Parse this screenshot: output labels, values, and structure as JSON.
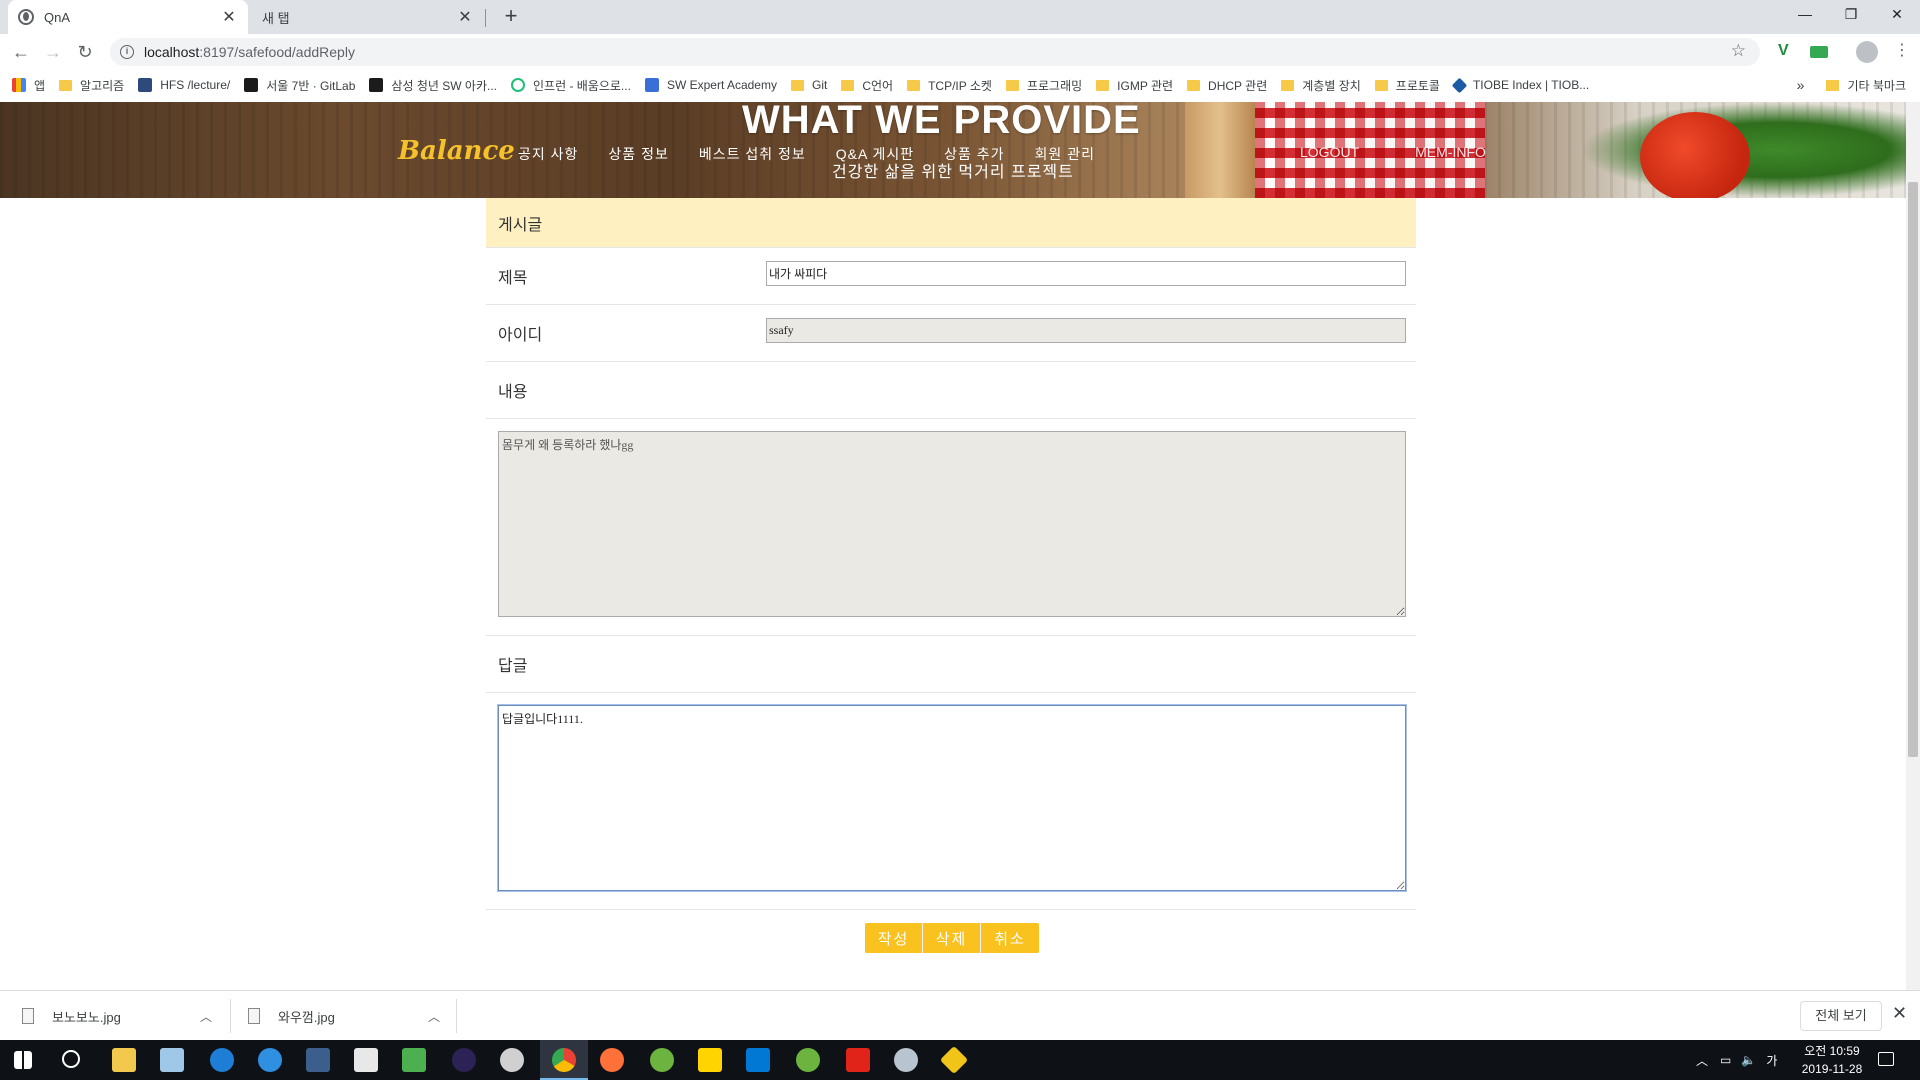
{
  "browser": {
    "tabs": [
      {
        "title": "QnA",
        "active": true
      },
      {
        "title": "새 탭",
        "active": false
      }
    ],
    "url_host": "localhost",
    "url_path": ":8197/safefood/addReply",
    "bookmarks": [
      {
        "label": "앱",
        "kind": "apps"
      },
      {
        "label": "알고리즘",
        "kind": "folder"
      },
      {
        "label": "HFS /lecture/",
        "kind": "site"
      },
      {
        "label": "서울 7반 · GitLab",
        "kind": "site"
      },
      {
        "label": "삼성 청년 SW 아카...",
        "kind": "site"
      },
      {
        "label": "인프런 - 배움으로...",
        "kind": "site"
      },
      {
        "label": "SW Expert Academy",
        "kind": "site"
      },
      {
        "label": "Git",
        "kind": "folder"
      },
      {
        "label": "C언어",
        "kind": "folder"
      },
      {
        "label": "TCP/IP 소켓",
        "kind": "folder"
      },
      {
        "label": "프로그래밍",
        "kind": "folder"
      },
      {
        "label": "IGMP 관련",
        "kind": "folder"
      },
      {
        "label": "DHCP 관련",
        "kind": "folder"
      },
      {
        "label": "계층별 장치",
        "kind": "folder"
      },
      {
        "label": "프로토콜",
        "kind": "folder"
      },
      {
        "label": "TIOBE Index | TIOB...",
        "kind": "site"
      }
    ],
    "bookmarks_more": "»",
    "other_bookmarks": "기타 북마크"
  },
  "header": {
    "brand": "Balance",
    "nav": [
      "공지 사항",
      "상품 정보",
      "베스트 섭취 정보",
      "Q&A 게시판",
      "상품 추가",
      "회원 관리"
    ],
    "hero_title": "WHAT WE PROVIDE",
    "hero_subtitle": "건강한 삶을 위한 먹거리 프로젝트",
    "user_nav": [
      "LOGOUT",
      "MEM-INFO"
    ]
  },
  "form": {
    "section_title": "게시글",
    "title_label": "제목",
    "title_value": "내가 싸피다",
    "id_label": "아이디",
    "id_value": "ssafy",
    "content_label": "내용",
    "content_value": "몸무게 왜 등록하라 했나gg",
    "reply_label": "답글",
    "reply_value": "답글입니다1111.",
    "buttons": {
      "write": "작성",
      "delete": "삭제",
      "cancel": "취소"
    }
  },
  "downloads": {
    "items": [
      "보노보노.jpg",
      "와우껌.jpg"
    ],
    "show_all": "전체 보기"
  },
  "taskbar": {
    "time": "오전 10:59",
    "date": "2019-11-28",
    "ime": "가"
  }
}
